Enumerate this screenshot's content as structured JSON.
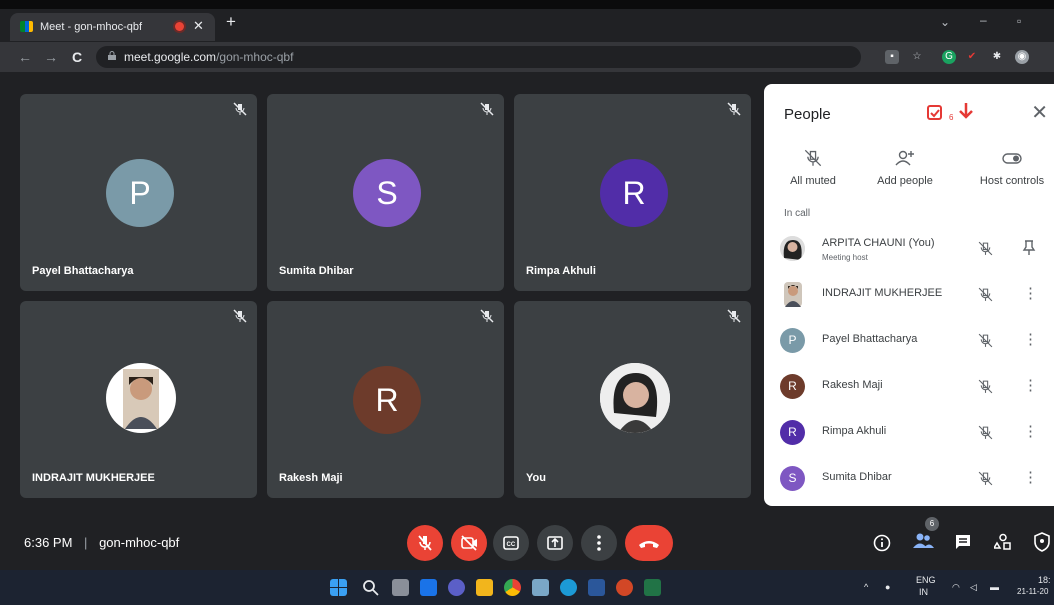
{
  "browser": {
    "tab_title": "Meet - gon-mhoc-qbf",
    "url_host": "meet.google.com",
    "url_path": "/gon-mhoc-qbf"
  },
  "tiles": [
    {
      "name": "Payel Bhattacharya",
      "initial": "P",
      "color": "#7a9aa8"
    },
    {
      "name": "Sumita Dhibar",
      "initial": "S",
      "color": "#7e57c2"
    },
    {
      "name": "Rimpa Akhuli",
      "initial": "R",
      "color": "#512da8"
    },
    {
      "name": "INDRAJIT MUKHERJEE",
      "initial": "",
      "color": ""
    },
    {
      "name": "Rakesh Maji",
      "initial": "R",
      "color": "#6d3b2b"
    },
    {
      "name": "You",
      "initial": "",
      "color": ""
    }
  ],
  "panel": {
    "title": "People",
    "badge_count": "6",
    "actions": [
      "All muted",
      "Add people",
      "Host controls"
    ],
    "section": "In call",
    "participants": [
      {
        "name": "ARPITA CHAUNI (You)",
        "sub": "Meeting host",
        "initial": "",
        "color": "#555",
        "extra": "pin-icon"
      },
      {
        "name": "INDRAJIT MUKHERJEE",
        "sub": "",
        "initial": "",
        "color": "#888",
        "extra": "more-icon"
      },
      {
        "name": "Payel Bhattacharya",
        "sub": "",
        "initial": "P",
        "color": "#7a9aa8",
        "extra": "more-icon"
      },
      {
        "name": "Rakesh Maji",
        "sub": "",
        "initial": "R",
        "color": "#6d3b2b",
        "extra": "more-icon"
      },
      {
        "name": "Rimpa Akhuli",
        "sub": "",
        "initial": "R",
        "color": "#512da8",
        "extra": "more-icon"
      },
      {
        "name": "Sumita Dhibar",
        "sub": "",
        "initial": "S",
        "color": "#7e57c2",
        "extra": "more-icon"
      }
    ]
  },
  "bottom": {
    "time": "6:36 PM",
    "separator": "|",
    "meeting_code": "gon-mhoc-qbf",
    "people_count": "6"
  },
  "taskbar": {
    "lang_top": "ENG",
    "lang_bottom": "IN",
    "time": "18:",
    "date": "21-11-20"
  },
  "colors": {
    "end_call": "#ea4335",
    "muted_red": "#ea4335",
    "accent_blue": "#8ab4f8"
  }
}
